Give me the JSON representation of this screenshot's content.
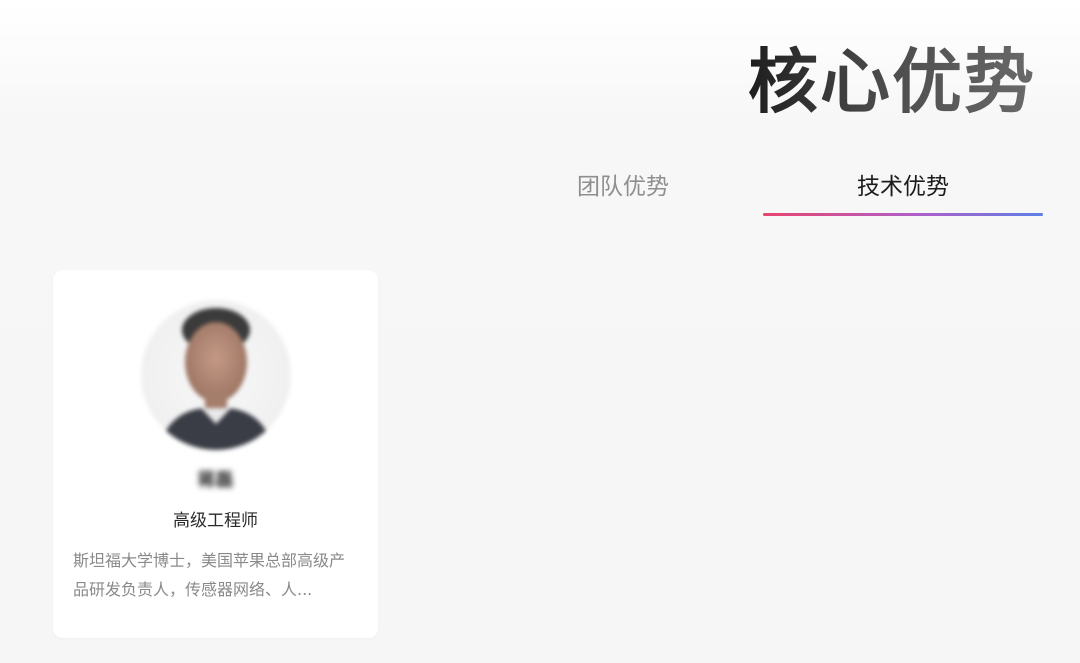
{
  "header": {
    "title": "核心优势"
  },
  "tabs": [
    {
      "label": "团队优势",
      "active": false
    },
    {
      "label": "技术优势",
      "active": true
    }
  ],
  "tab_underline_colors": [
    "#e8456e",
    "#b05fc9",
    "#5c7fe6"
  ],
  "member_card": {
    "avatar_icon": "person-photo-blurred",
    "name": "蒋磊",
    "role": "高级工程师",
    "description": "斯坦福大学博士，美国苹果总部高级产品研发负责人，传感器网络、人..."
  }
}
